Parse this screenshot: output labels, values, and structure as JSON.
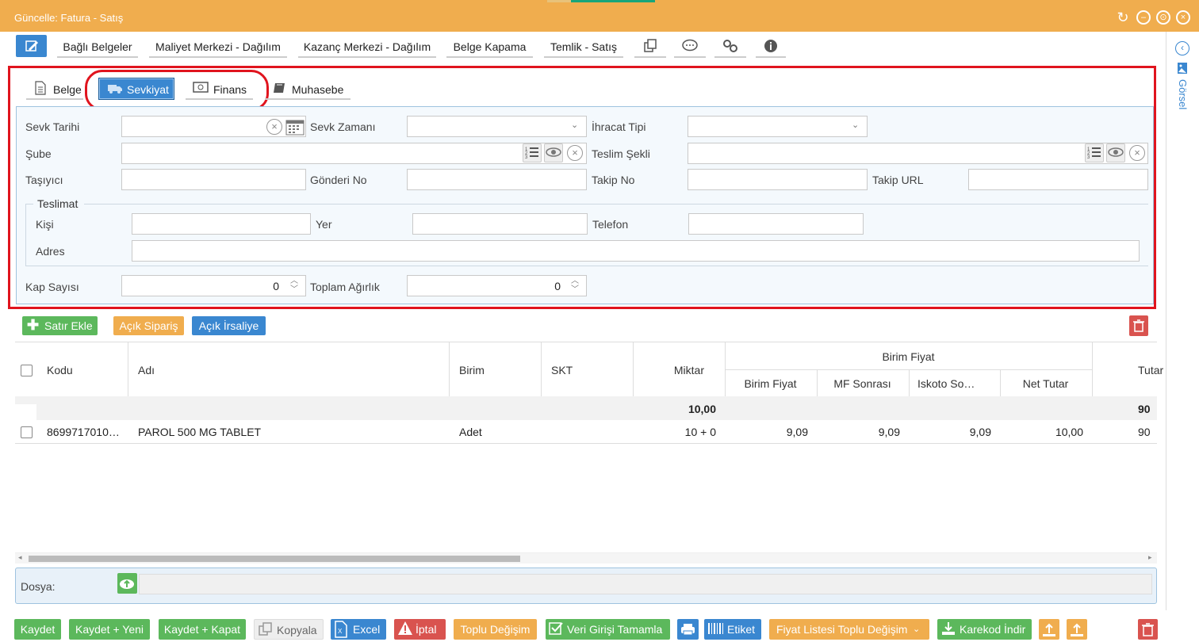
{
  "window": {
    "title": "Güncelle: Fatura - Satış"
  },
  "toolbar": {
    "items": [
      "Bağlı Belgeler",
      "Maliyet Merkezi - Dağılım",
      "Kazanç Merkezi - Dağılım",
      "Belge Kapama",
      "Temlik - Satış"
    ],
    "icons": [
      "copy-icon",
      "comment-icon",
      "link-icon",
      "info-icon"
    ]
  },
  "tabs": {
    "belge": "Belge",
    "sevkiyat": "Sevkiyat",
    "finans": "Finans",
    "muhasebe": "Muhasebe",
    "active": "Sevkiyat"
  },
  "form": {
    "sevk_tarihi": "Sevk Tarihi",
    "sevk_zamani": "Sevk Zamanı",
    "ihracat_tipi": "İhracat Tipi",
    "sube": "Şube",
    "teslim_sekli": "Teslim Şekli",
    "tasiyici": "Taşıyıcı",
    "gonderi_no": "Gönderi No",
    "takip_no": "Takip No",
    "takip_url": "Takip URL",
    "teslimat": "Teslimat",
    "kisi": "Kişi",
    "yer": "Yer",
    "telefon": "Telefon",
    "adres": "Adres",
    "kap_sayisi": "Kap Sayısı",
    "kap_sayisi_value": "0",
    "toplam_agirlik": "Toplam Ağırlık",
    "toplam_agirlik_value": "0"
  },
  "grid_actions": {
    "satir_ekle": "Satır Ekle",
    "acik_siparis": "Açık Sipariş",
    "acik_irsaliye": "Açık İrsaliye"
  },
  "grid": {
    "headers": {
      "kodu": "Kodu",
      "adi": "Adı",
      "birim": "Birim",
      "skt": "SKT",
      "miktar": "Miktar",
      "birim_fiyat_group": "Birim Fiyat",
      "birim_fiyat": "Birim Fiyat",
      "mf_sonrasi": "MF Sonrası",
      "iskoto": "Iskoto So…",
      "net_tutar": "Net Tutar",
      "tutar": "Tutar"
    },
    "summary": {
      "miktar": "10,00",
      "tutar": "90"
    },
    "rows": [
      {
        "kodu": "8699717010…",
        "adi": "PAROL 500 MG TABLET",
        "birim": "Adet",
        "skt": "",
        "miktar": "10 + 0",
        "birim_fiyat": "9,09",
        "mf_sonrasi": "9,09",
        "iskoto": "9,09",
        "net_tutar": "10,00",
        "tutar": "90"
      }
    ]
  },
  "dosya": {
    "label": "Dosya:"
  },
  "side": {
    "gorsel": "Görsel"
  },
  "footer": {
    "kaydet": "Kaydet",
    "kaydet_yeni": "Kaydet + Yeni",
    "kaydet_kapat": "Kaydet + Kapat",
    "kopyala": "Kopyala",
    "excel": "Excel",
    "iptal": "İptal",
    "toplu_degisim": "Toplu Değişim",
    "veri_girisi": "Veri Girişi Tamamla",
    "etiket": "Etiket",
    "fiyat_listesi": "Fiyat Listesi Toplu Değişim",
    "karekod_indir": "Karekod İndir"
  },
  "colors": {
    "titlebar": "#f0ad4e",
    "primary": "#3a87d0",
    "success": "#5cb85c",
    "danger": "#d9534f",
    "highlight": "#e0141e"
  }
}
